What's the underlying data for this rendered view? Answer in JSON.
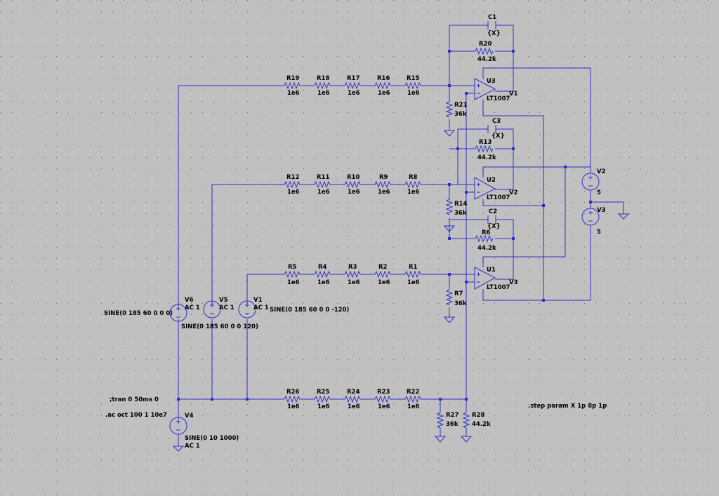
{
  "schematic": {
    "resistors_top": [
      {
        "name": "R19",
        "value": "1e6"
      },
      {
        "name": "R18",
        "value": "1e6"
      },
      {
        "name": "R17",
        "value": "1e6"
      },
      {
        "name": "R16",
        "value": "1e6"
      },
      {
        "name": "R15",
        "value": "1e6"
      }
    ],
    "resistors_mid": [
      {
        "name": "R12",
        "value": "1e6"
      },
      {
        "name": "R11",
        "value": "1e6"
      },
      {
        "name": "R10",
        "value": "1e6"
      },
      {
        "name": "R9",
        "value": "1e6"
      },
      {
        "name": "R8",
        "value": "1e6"
      }
    ],
    "resistors_low": [
      {
        "name": "R5",
        "value": "1e6"
      },
      {
        "name": "R4",
        "value": "1e6"
      },
      {
        "name": "R3",
        "value": "1e6"
      },
      {
        "name": "R2",
        "value": "1e6"
      },
      {
        "name": "R1",
        "value": "1e6"
      }
    ],
    "resistors_bottom": [
      {
        "name": "R26",
        "value": "1e6"
      },
      {
        "name": "R25",
        "value": "1e6"
      },
      {
        "name": "R24",
        "value": "1e6"
      },
      {
        "name": "R23",
        "value": "1e6"
      },
      {
        "name": "R22",
        "value": "1e6"
      }
    ],
    "stages": [
      {
        "cap": "C1",
        "cap_value": "{X}",
        "rf": "R20",
        "rf_value": "44.2k",
        "opamp": "U3",
        "opamp_model": "LT1007",
        "rg": "R21",
        "rg_value": "36k",
        "out": "V1"
      },
      {
        "cap": "C3",
        "cap_value": "{X}",
        "rf": "R13",
        "rf_value": "44.2k",
        "opamp": "U2",
        "opamp_model": "LT1007",
        "rg": "R14",
        "rg_value": "36k",
        "out": "V2"
      },
      {
        "cap": "C2",
        "cap_value": "{X}",
        "rf": "R6",
        "rf_value": "44.2k",
        "opamp": "U1",
        "opamp_model": "LT1007",
        "rg": "R7",
        "rg_value": "36k",
        "out": "V3"
      }
    ],
    "sources": [
      {
        "name": "V6",
        "ac": "AC 1",
        "spec": "SINE(0 185 60 0 0 0)"
      },
      {
        "name": "V5",
        "ac": "AC 1",
        "spec": "SINE(0 185 60 0 0 120)"
      },
      {
        "name": "V1",
        "ac": "AC 1",
        "spec": "SINE(0 185 60 0 0 -120)"
      },
      {
        "name": "V4",
        "ac": "AC 1",
        "spec": "SINE(0 10 1000)"
      }
    ],
    "supplies": [
      {
        "name": "V2",
        "value": "5"
      },
      {
        "name": "V3",
        "value": "5"
      }
    ],
    "r27": {
      "name": "R27",
      "value": "36k"
    },
    "r28": {
      "name": "R28",
      "value": "44.2k"
    },
    "directives": {
      "tran": ";tran 0 50ms 0",
      "ac": ".ac oct 100 1 10e7",
      "step": ".step param X 1p 8p 1p"
    }
  }
}
